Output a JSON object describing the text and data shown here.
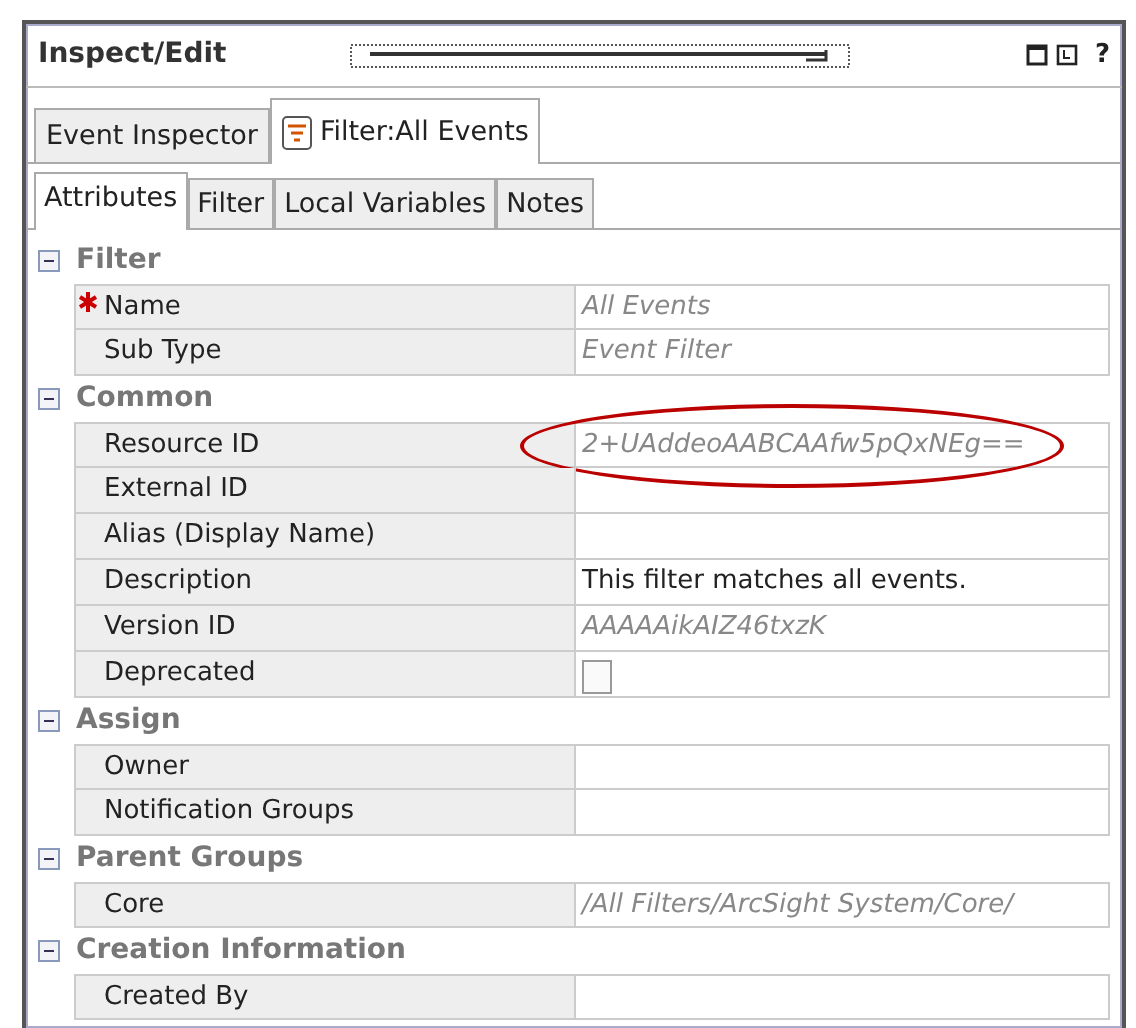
{
  "window": {
    "title": "Inspect/Edit",
    "help": "?"
  },
  "editor_tabs": [
    {
      "label": "Event Inspector",
      "selected": false,
      "icon": false
    },
    {
      "label": "Filter:All Events",
      "selected": true,
      "icon": true
    }
  ],
  "tabs": [
    {
      "label": "Attributes",
      "selected": true
    },
    {
      "label": "Filter",
      "selected": false
    },
    {
      "label": "Local Variables",
      "selected": false
    },
    {
      "label": "Notes",
      "selected": false
    }
  ],
  "groups": [
    {
      "title": "Filter",
      "expanded": true,
      "rows": [
        {
          "kind": "text",
          "label": "Name",
          "required": true,
          "value": "All Events",
          "readonly": true
        },
        {
          "kind": "text",
          "label": "Sub Type",
          "value": "Event Filter",
          "readonly": true
        }
      ]
    },
    {
      "title": "Common",
      "expanded": true,
      "rows": [
        {
          "kind": "text",
          "label": "Resource ID",
          "value": "2+UAddeoAABCAAfw5pQxNEg==",
          "readonly": true,
          "highlighted": true
        },
        {
          "kind": "text",
          "label": "External ID"
        },
        {
          "kind": "text",
          "label": "Alias (Display Name)"
        },
        {
          "kind": "text",
          "label": "Description",
          "value": "This filter matches all events.",
          "readonly": false
        },
        {
          "kind": "text",
          "label": "Version ID",
          "value": "AAAAAikAIZ46txzK",
          "readonly": true
        },
        {
          "kind": "checkbox",
          "label": "Deprecated",
          "checked": false
        }
      ]
    },
    {
      "title": "Assign",
      "expanded": true,
      "rows": [
        {
          "kind": "text",
          "label": "Owner"
        },
        {
          "kind": "text",
          "label": "Notification Groups"
        }
      ]
    },
    {
      "title": "Parent Groups",
      "expanded": true,
      "rows": [
        {
          "kind": "text",
          "label": "Core",
          "value": "/All Filters/ArcSight System/Core/",
          "readonly": true
        }
      ]
    },
    {
      "title": "Creation Information",
      "expanded": true,
      "rows": [
        {
          "kind": "text",
          "label": "Created By"
        }
      ]
    }
  ]
}
